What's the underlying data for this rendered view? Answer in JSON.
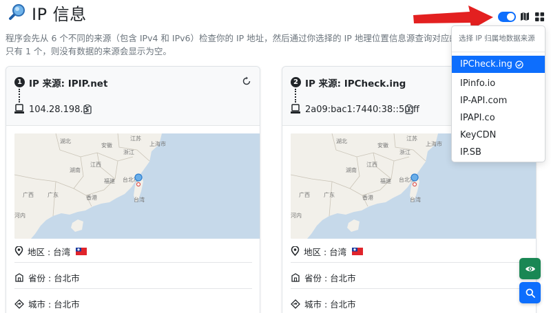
{
  "page": {
    "title": "IP 信息",
    "description_line1": "程序会先从 6 个不同的来源（包含 IPv4 和 IPv6）检查你的 IP 地址，然后通过你选择的 IP 地理位置信息源查询对应的地理",
    "description_line2": "只有 1 个，则没有数据的来源会显示为空。"
  },
  "colors": {
    "primary": "#0d6efd",
    "success": "#198754",
    "arrow": "#e32020",
    "map_sea": "#c6d9ea",
    "map_land": "#f2f0ea"
  },
  "cards": [
    {
      "number": "1",
      "source_label": "IP 来源: IPIP.net",
      "ip": "104.28.198.3",
      "map_labels": [
        "湖北",
        "安徽",
        "江苏",
        "上海市",
        "浙江",
        "湖南",
        "江西",
        "福建",
        "台北市",
        "台湾",
        "广东",
        "广西",
        "香港",
        "河内"
      ],
      "region_label": "地区 : 台湾",
      "province_label": "省份 : 台北市",
      "city_label": "城市 : 台北市"
    },
    {
      "number": "2",
      "source_label": "IP 来源: IPCheck.ing",
      "ip": "2a09:bac1:7440:38::50:ff",
      "map_labels": [
        "湖北",
        "安徽",
        "江苏",
        "上海市",
        "浙江",
        "湖南",
        "江西",
        "福建",
        "台北市",
        "台湾",
        "广东",
        "广西",
        "香港",
        "河内"
      ],
      "region_label": "地区 : 台湾",
      "province_label": "省份 : 台北市",
      "city_label": "城市 : 台北市"
    }
  ],
  "dropdown": {
    "header": "选择 IP 归属地数据来源",
    "items": [
      "IPCheck.ing",
      "IPinfo.io",
      "IP-API.com",
      "IPAPI.co",
      "KeyCDN",
      "IP.SB"
    ],
    "selected": "IPCheck.ing"
  },
  "toolbar": {
    "toggle_state": "on",
    "icons": [
      "toggle-switch",
      "map-icon",
      "grid-icon"
    ]
  },
  "fabs": {
    "icons": [
      "eye-icon",
      "search-icon"
    ]
  }
}
